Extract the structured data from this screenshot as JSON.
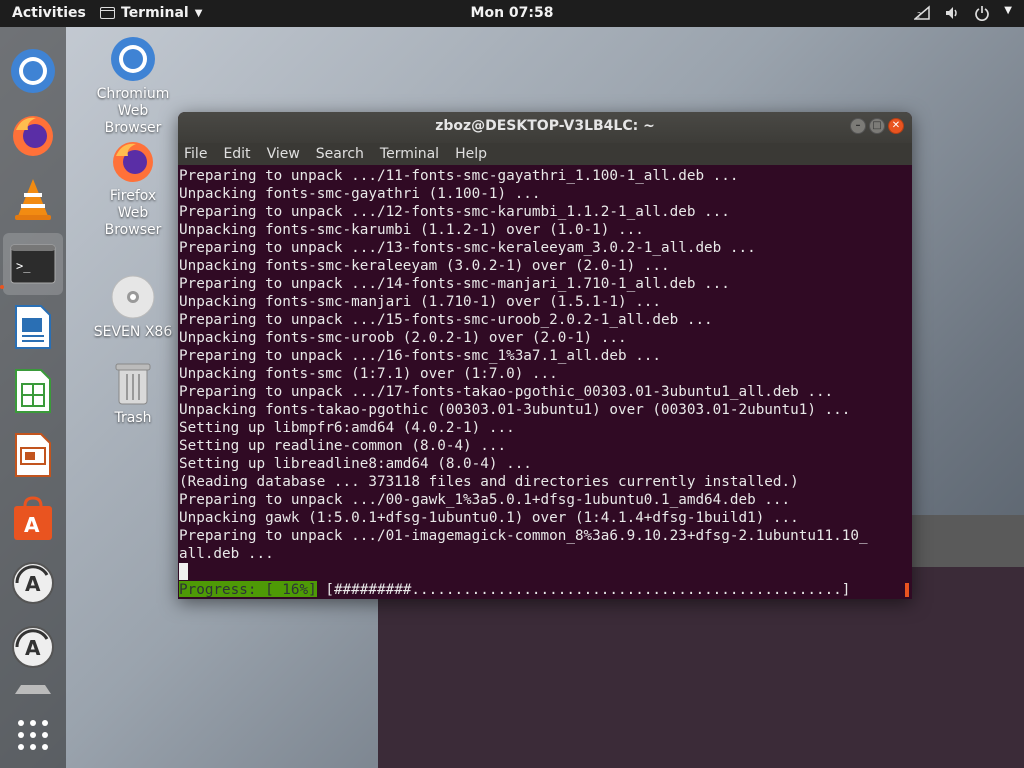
{
  "topbar": {
    "activities": "Activities",
    "app_menu": "Terminal",
    "clock": "Mon 07:58"
  },
  "desktop": {
    "icons": [
      {
        "label": "Chromium\nWeb\nBrowser"
      },
      {
        "label": "Firefox\nWeb\nBrowser"
      },
      {
        "label": "SEVEN X86"
      },
      {
        "label": "Trash"
      }
    ]
  },
  "terminal": {
    "title": "zboz@DESKTOP-V3LB4LC: ~",
    "menu": [
      "File",
      "Edit",
      "View",
      "Search",
      "Terminal",
      "Help"
    ],
    "lines": [
      "Preparing to unpack .../11-fonts-smc-gayathri_1.100-1_all.deb ...",
      "Unpacking fonts-smc-gayathri (1.100-1) ...",
      "Preparing to unpack .../12-fonts-smc-karumbi_1.1.2-1_all.deb ...",
      "Unpacking fonts-smc-karumbi (1.1.2-1) over (1.0-1) ...",
      "Preparing to unpack .../13-fonts-smc-keraleeyam_3.0.2-1_all.deb ...",
      "Unpacking fonts-smc-keraleeyam (3.0.2-1) over (2.0-1) ...",
      "Preparing to unpack .../14-fonts-smc-manjari_1.710-1_all.deb ...",
      "Unpacking fonts-smc-manjari (1.710-1) over (1.5.1-1) ...",
      "Preparing to unpack .../15-fonts-smc-uroob_2.0.2-1_all.deb ...",
      "Unpacking fonts-smc-uroob (2.0.2-1) over (2.0-1) ...",
      "Preparing to unpack .../16-fonts-smc_1%3a7.1_all.deb ...",
      "Unpacking fonts-smc (1:7.1) over (1:7.0) ...",
      "Preparing to unpack .../17-fonts-takao-pgothic_00303.01-3ubuntu1_all.deb ...",
      "Unpacking fonts-takao-pgothic (00303.01-3ubuntu1) over (00303.01-2ubuntu1) ...",
      "Setting up libmpfr6:amd64 (4.0.2-1) ...",
      "Setting up readline-common (8.0-4) ...",
      "Setting up libreadline8:amd64 (8.0-4) ...",
      "(Reading database ... 373118 files and directories currently installed.)",
      "Preparing to unpack .../00-gawk_1%3a5.0.1+dfsg-1ubuntu0.1_amd64.deb ...",
      "Unpacking gawk (1:5.0.1+dfsg-1ubuntu0.1) over (1:4.1.4+dfsg-1build1) ...",
      "Preparing to unpack .../01-imagemagick-common_8%3a6.9.10.23+dfsg-2.1ubuntu11.10_",
      "all.deb ..."
    ],
    "progress_label": "Progress: [ 16%]",
    "progress_bar": "[#########..................................................]",
    "progress_percent": 16
  }
}
